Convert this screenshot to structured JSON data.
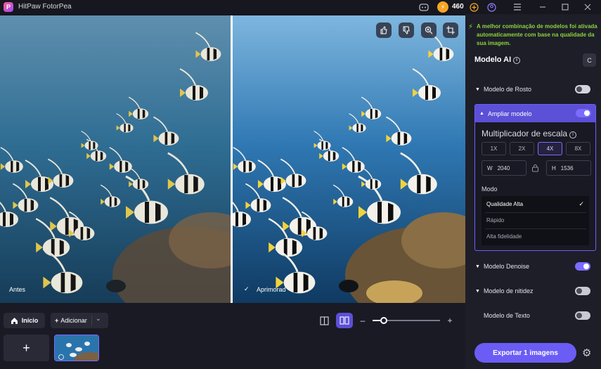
{
  "app": {
    "title": "HitPaw FotorPea",
    "coins": "460"
  },
  "window_controls": {
    "discord": "discord-icon",
    "coin": "coin-icon",
    "add": "plus-circle-icon",
    "account": "user-icon",
    "menu": "menu-icon",
    "minimize": "minimize-icon",
    "maximize": "maximize-icon",
    "close": "close-icon"
  },
  "preview": {
    "left_tag": "Antes",
    "right_tag": "Aprimorad",
    "overlay_buttons": [
      "thumbs-up-icon",
      "thumbs-down-icon",
      "zoom-icon",
      "crop-icon"
    ]
  },
  "bottom": {
    "home_label": "Início",
    "add_label": "Adicionar",
    "add_thumb_symbol": "+"
  },
  "sidebar": {
    "notice": "A melhor combinação de modelos foi ativada automaticamente com base na qualidade da sua imagem.",
    "section_title": "Modelo AI",
    "reset_symbol": "C",
    "models": [
      {
        "label": "Modelo de Rosto",
        "enabled": false
      },
      {
        "label": "Ampliar modelo",
        "enabled": true
      },
      {
        "label": "Modelo Denoise",
        "enabled": true
      },
      {
        "label": "Modelo de nitidez",
        "enabled": false
      },
      {
        "label": "Modelo de Texto",
        "enabled": false
      }
    ],
    "upscale": {
      "multiplier_label": "Multiplicador de escala",
      "scales": [
        "1X",
        "2X",
        "4X",
        "8X"
      ],
      "selected_scale": "4X",
      "width_label": "W",
      "width_value": "2040",
      "height_label": "H",
      "height_value": "1536",
      "mode_label": "Modo",
      "modes": [
        "Qualidade Alta",
        "Rápido",
        "Alta fidelidade"
      ],
      "selected_mode": "Qualidade Alta"
    },
    "export_label": "Exportar 1 imagens"
  }
}
